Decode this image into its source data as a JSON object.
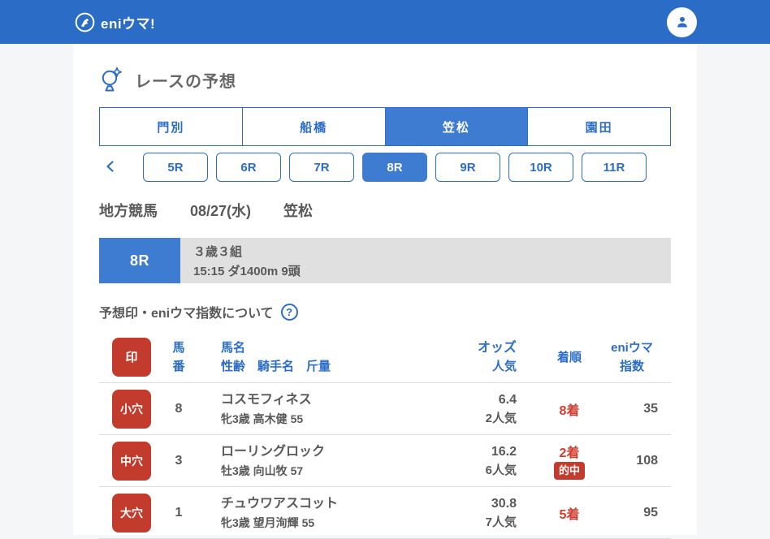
{
  "colors": {
    "header_blue": "#2a6cc6",
    "accent_blue": "#2b6dc7",
    "selected_blue": "#3e7cd1",
    "badge_red": "#c23b2c",
    "result_red": "#d23c2e",
    "banner_gray": "#e0e0e0",
    "background": "#f5f6f7"
  },
  "header": {
    "logo_text": "eniウマ!",
    "logo_icon": "horse-in-circle-icon",
    "avatar_icon": "person-icon"
  },
  "page": {
    "title": "レースの予想",
    "title_icon": "crystal-ball-icon"
  },
  "venue_tabs": {
    "items": [
      {
        "label": "門別",
        "selected": false
      },
      {
        "label": "船橋",
        "selected": false
      },
      {
        "label": "笠松",
        "selected": true
      },
      {
        "label": "園田",
        "selected": false
      }
    ]
  },
  "race_selector": {
    "prev_icon": "chevron-left-icon",
    "items": [
      {
        "label": "5R",
        "selected": false
      },
      {
        "label": "6R",
        "selected": false
      },
      {
        "label": "7R",
        "selected": false
      },
      {
        "label": "8R",
        "selected": true
      },
      {
        "label": "9R",
        "selected": false
      },
      {
        "label": "10R",
        "selected": false
      },
      {
        "label": "11R",
        "selected": false
      }
    ]
  },
  "meta": {
    "category": "地方競馬",
    "date": "08/27(水)",
    "venue": "笠松"
  },
  "race_banner": {
    "race_no": "8R",
    "class_name": "３歳３組",
    "details": "15:15 ダ1400m 9頭"
  },
  "info_link": {
    "label": "予想印・eniウマ指数について",
    "help_icon": "?"
  },
  "table": {
    "headers": {
      "mark": "印",
      "number": [
        "馬",
        "番"
      ],
      "name": [
        "馬名",
        "性齢　騎手名　斤量"
      ],
      "odds": [
        "オッズ",
        "人気"
      ],
      "result": "着順",
      "index": [
        "eniウマ",
        "指数"
      ]
    },
    "rows": [
      {
        "mark": "小穴",
        "number": "8",
        "name": "コスモフィネス",
        "detail": "牝3歳 高木健 55",
        "odds": "6.4",
        "popularity": "2人気",
        "result": "8着",
        "index": "35"
      },
      {
        "mark": "中穴",
        "number": "3",
        "name": "ローリングロック",
        "detail": "牡3歳 向山牧 57",
        "odds": "16.2",
        "popularity": "6人気",
        "result": "2着",
        "hit_badge": "的中",
        "index": "108"
      },
      {
        "mark": "大穴",
        "number": "1",
        "name": "チュウワアスコット",
        "detail": "牝3歳 望月洵輝 55",
        "odds": "30.8",
        "popularity": "7人気",
        "result": "5着",
        "index": "95"
      }
    ]
  }
}
